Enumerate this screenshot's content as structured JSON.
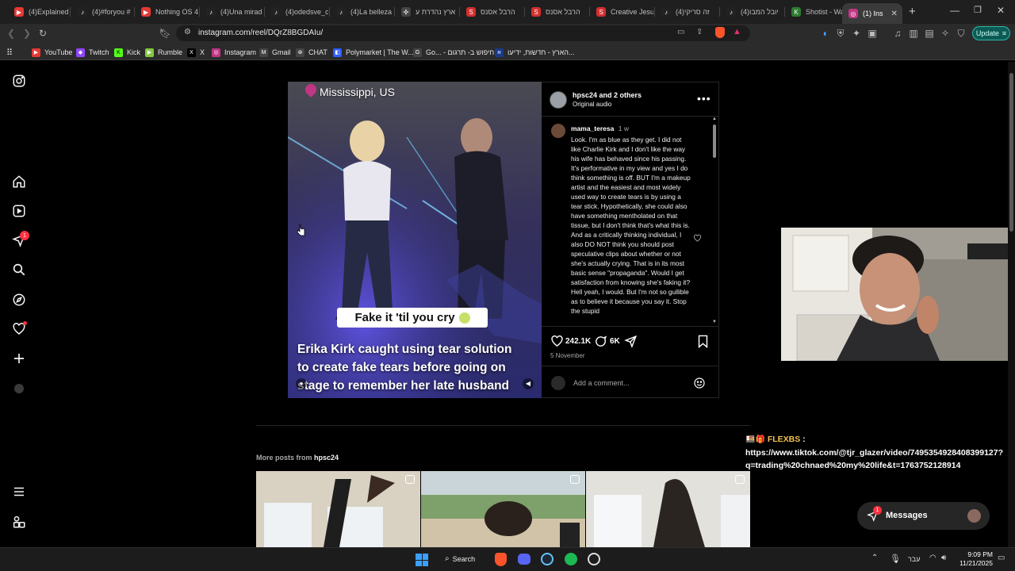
{
  "browser": {
    "tabs": [
      {
        "label": "(4)Explained",
        "color": "#e53935",
        "glyph": "▶"
      },
      {
        "label": "(4)#foryou #",
        "color": "#222",
        "glyph": "♪"
      },
      {
        "label": "Nothing OS 4",
        "color": "#e53935",
        "glyph": "▶"
      },
      {
        "label": "(4)Una mirad",
        "color": "#222",
        "glyph": "♪"
      },
      {
        "label": "(4)odedsve_c",
        "color": "#222",
        "glyph": "♪"
      },
      {
        "label": "(4)La belleza",
        "color": "#222",
        "glyph": "♪"
      },
      {
        "label": "ארץ נהדרת ע",
        "color": "#444",
        "glyph": "✣"
      },
      {
        "label": "הרבל אסנס",
        "color": "#d32f2f",
        "glyph": "S"
      },
      {
        "label": "הרבל אסנס",
        "color": "#d32f2f",
        "glyph": "S"
      },
      {
        "label": "Creative Jesu",
        "color": "#d32f2f",
        "glyph": "S"
      },
      {
        "label": "(4)זה סריקי",
        "color": "#222",
        "glyph": "♪"
      },
      {
        "label": "(4)יובל המבו",
        "color": "#222",
        "glyph": "♪"
      },
      {
        "label": "Shotist - Wat",
        "color": "#2e7d32",
        "glyph": "K"
      },
      {
        "label": "(1) Ins",
        "color": "#c13584",
        "glyph": "◎"
      }
    ],
    "new_tab": "+",
    "url": "instagram.com/reel/DQrZ8BGDAIu/",
    "update_label": "Update"
  },
  "bookmarks": [
    {
      "label": "YouTube",
      "color": "#e53935",
      "glyph": "▶"
    },
    {
      "label": "Twitch",
      "color": "#9146ff",
      "glyph": "◆"
    },
    {
      "label": "Kick",
      "color": "#53fc18",
      "glyph": "K"
    },
    {
      "label": "Rumble",
      "color": "#85c742",
      "glyph": "▶"
    },
    {
      "label": "X",
      "color": "#000",
      "glyph": "X"
    },
    {
      "label": "Instagram",
      "color": "#c13584",
      "glyph": "◎"
    },
    {
      "label": "Gmail",
      "color": "#444",
      "glyph": "M"
    },
    {
      "label": "CHAT",
      "color": "#444",
      "glyph": "⊛"
    },
    {
      "label": "Polymarket | The W...",
      "color": "#2e5bff",
      "glyph": "◧"
    },
    {
      "label": "Go... - חיפוש ב- תרגום",
      "color": "#444",
      "glyph": "G"
    },
    {
      "label": "הארץ - חדשות, ידיעו...",
      "color": "#1a3a8a",
      "glyph": "א"
    }
  ],
  "reel": {
    "location": "Mississippi, US",
    "sticker_text": "Fake it 'til you cry",
    "caption_lines": [
      "Erika Kirk caught using tear solution",
      "to create fake tears before going on",
      "stage to remember her late husband"
    ],
    "author_line": "hpsc24",
    "author_others": "and 2 others",
    "audio": "Original audio",
    "comment_user": "mama_teresa",
    "comment_age": "1 w",
    "comment_text": "Look. I'm as blue as they get. I did not like Charlie Kirk and I don't like the way his wife has behaved since his passing. It's performative in my view and yes I do think something is off. BUT I'm a makeup artist and the easiest and most widely used way to create tears is by using a tear stick. Hypothetically, she could also have something mentholated on that tissue, but I don't think that's what this is. And as a critically thinking individual, I also DO NOT think you should post speculative clips about whether or not she's actually crying. That is in its most basic sense \"propaganda\". Would I get satisfaction from knowing she's faking it? Hell yeah, I would. But I'm not so gullible as to believe it because you say it. Stop the stupid",
    "likes": "242.1K",
    "comments": "6K",
    "date": "5 November",
    "comment_placeholder": "Add a comment..."
  },
  "more_posts": {
    "prefix": "More posts from",
    "user": "hpsc24"
  },
  "chat_overlay": {
    "user": "FLEXBS",
    "emojis": "🍱🎁",
    "line1": "https://www.tiktok.com/@tjr_glazer/video/7495354928408399127?",
    "line2": "q=trading%20chnaed%20my%20life&t=1763752128914"
  },
  "messages": {
    "label": "Messages",
    "badge": "1"
  },
  "notifications_badge": "1",
  "taskbar": {
    "search": "Search",
    "lang": "עבר",
    "time": "9:09 PM",
    "date": "11/21/2025"
  },
  "colors": {
    "accent": "#0095f6",
    "badge": "#ff3040",
    "chat_user": "#f2c14e"
  }
}
